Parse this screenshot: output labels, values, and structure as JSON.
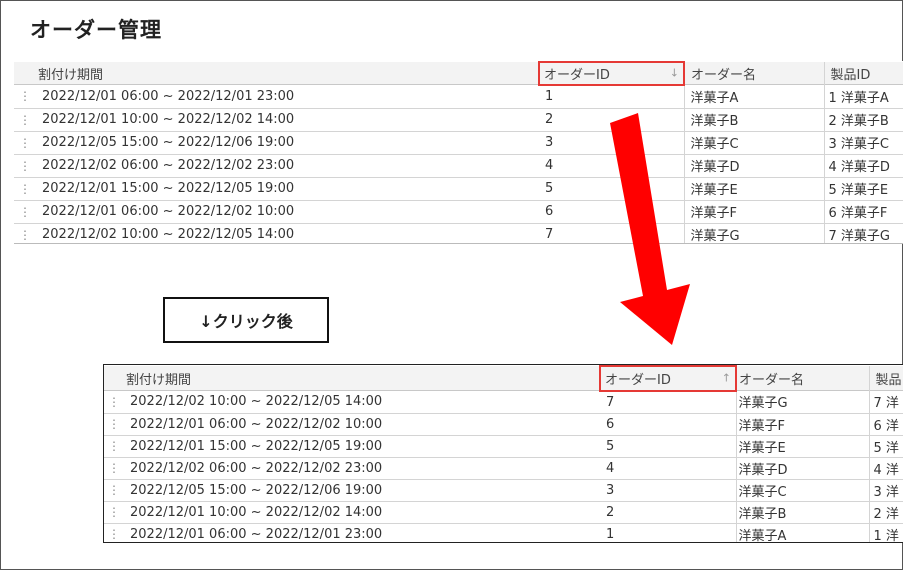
{
  "title": "オーダー管理",
  "columns": {
    "period": "割付け期間",
    "order_id": "オーダーID",
    "order_name": "オーダー名",
    "product_id": "製品ID",
    "product_id_cut": "製品"
  },
  "sort_icons": {
    "desc": "↓",
    "asc": "↑"
  },
  "grip": "⋮",
  "before_rows": [
    {
      "period": "2022/12/01 06:00 ~ 2022/12/01 23:00",
      "id": "1",
      "name": "洋菓子A",
      "product": "1 洋菓子A"
    },
    {
      "period": "2022/12/01 10:00 ~ 2022/12/02 14:00",
      "id": "2",
      "name": "洋菓子B",
      "product": "2 洋菓子B"
    },
    {
      "period": "2022/12/05 15:00 ~ 2022/12/06 19:00",
      "id": "3",
      "name": "洋菓子C",
      "product": "3 洋菓子C"
    },
    {
      "period": "2022/12/02 06:00 ~ 2022/12/02 23:00",
      "id": "4",
      "name": "洋菓子D",
      "product": "4 洋菓子D"
    },
    {
      "period": "2022/12/01 15:00 ~ 2022/12/05 19:00",
      "id": "5",
      "name": "洋菓子E",
      "product": "5 洋菓子E"
    },
    {
      "period": "2022/12/01 06:00 ~ 2022/12/02 10:00",
      "id": "6",
      "name": "洋菓子F",
      "product": "6 洋菓子F"
    },
    {
      "period": "2022/12/02 10:00 ~ 2022/12/05 14:00",
      "id": "7",
      "name": "洋菓子G",
      "product": "7 洋菓子G"
    }
  ],
  "click_label": "↓クリック後",
  "after_rows": [
    {
      "period": "2022/12/02 10:00 ~ 2022/12/05 14:00",
      "id": "7",
      "name": "洋菓子G",
      "product": "7 洋"
    },
    {
      "period": "2022/12/01 06:00 ~ 2022/12/02 10:00",
      "id": "6",
      "name": "洋菓子F",
      "product": "6 洋"
    },
    {
      "period": "2022/12/01 15:00 ~ 2022/12/05 19:00",
      "id": "5",
      "name": "洋菓子E",
      "product": "5 洋"
    },
    {
      "period": "2022/12/02 06:00 ~ 2022/12/02 23:00",
      "id": "4",
      "name": "洋菓子D",
      "product": "4 洋"
    },
    {
      "period": "2022/12/05 15:00 ~ 2022/12/06 19:00",
      "id": "3",
      "name": "洋菓子C",
      "product": "3 洋"
    },
    {
      "period": "2022/12/01 10:00 ~ 2022/12/02 14:00",
      "id": "2",
      "name": "洋菓子B",
      "product": "2 洋"
    },
    {
      "period": "2022/12/01 06:00 ~ 2022/12/01 23:00",
      "id": "1",
      "name": "洋菓子A",
      "product": "1 洋"
    }
  ],
  "colors": {
    "highlight": "#e53935",
    "arrow": "#ff0000"
  }
}
